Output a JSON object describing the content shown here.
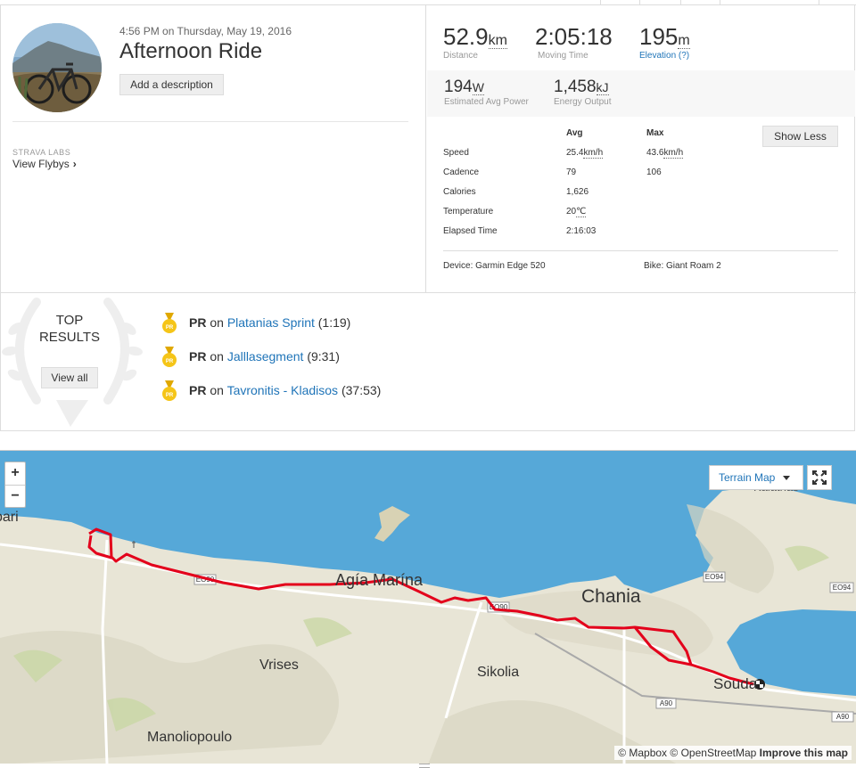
{
  "activity": {
    "date_time": "4:56 PM on Thursday, May 19, 2016",
    "title": "Afternoon Ride",
    "add_description": "Add a description",
    "labs_label": "STRAVA LABS",
    "view_flybys": "View Flybys"
  },
  "stats": {
    "distance": {
      "value": "52.9",
      "unit": "km",
      "label": "Distance"
    },
    "moving_time": {
      "value": "2:05:18",
      "label": "Moving Time"
    },
    "elevation": {
      "value": "195",
      "unit": "m",
      "label": "Elevation (?)"
    },
    "power": {
      "value": "194",
      "unit": "W",
      "label": "Estimated Avg Power"
    },
    "energy": {
      "value": "1,458",
      "unit": "kJ",
      "label": "Energy Output"
    }
  },
  "more_stats": {
    "headers": {
      "avg": "Avg",
      "max": "Max"
    },
    "show_less": "Show Less",
    "rows": [
      {
        "name": "Speed",
        "avg": "25.4",
        "avg_unit": "km/h",
        "max": "43.6",
        "max_unit": "km/h"
      },
      {
        "name": "Cadence",
        "avg": "79",
        "avg_unit": "",
        "max": "106",
        "max_unit": ""
      },
      {
        "name": "Calories",
        "avg": "1,626",
        "avg_unit": "",
        "max": "",
        "max_unit": ""
      },
      {
        "name": "Temperature",
        "avg": "20",
        "avg_unit": "℃",
        "max": "",
        "max_unit": ""
      },
      {
        "name": "Elapsed Time",
        "avg": "2:16:03",
        "avg_unit": "",
        "max": "",
        "max_unit": ""
      }
    ],
    "device": "Device: Garmin Edge 520",
    "bike": "Bike: Giant Roam 2"
  },
  "results": {
    "heading_line1": "TOP",
    "heading_line2": "RESULTS",
    "view_all": "View all",
    "items": [
      {
        "badge": "PR",
        "on": "on",
        "segment": "Platanias Sprint",
        "time": "(1:19)"
      },
      {
        "badge": "PR",
        "on": "on",
        "segment": "Jalllasegment",
        "time": "(9:31)"
      },
      {
        "badge": "PR",
        "on": "on",
        "segment": "Tavronitis - Kladisos",
        "time": "(37:53)"
      }
    ]
  },
  "map": {
    "zoom_in": "+",
    "zoom_out": "−",
    "map_type": "Terrain Map",
    "labels": {
      "bari": "bari",
      "agia_marina": "Agía Marína",
      "chania": "Chania",
      "vrises": "Vrises",
      "sikolia": "Sikolia",
      "manoliopoulo": "Manoliopoulo",
      "souda": "Souda",
      "kalathas": "Kalathas"
    },
    "road_badges": [
      "EO90",
      "EO90",
      "EO94",
      "EO94",
      "A90",
      "A90"
    ],
    "attribution": {
      "mapbox": "© Mapbox",
      "osm": "© OpenStreetMap",
      "improve": "Improve this map"
    },
    "colors": {
      "sea": "#56a8d8",
      "land": "#e9e6d9",
      "route": "#e3001b"
    }
  }
}
